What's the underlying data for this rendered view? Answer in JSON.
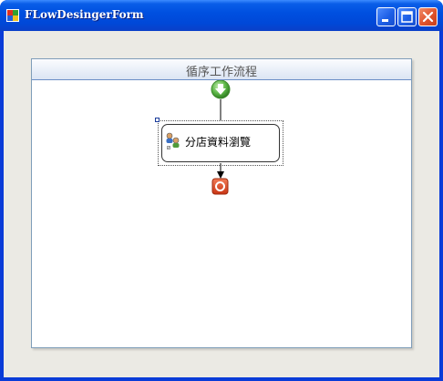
{
  "window": {
    "title": "FLowDesingerForm"
  },
  "title_buttons": {
    "minimize_icon": "minimize-icon",
    "maximize_icon": "maximize-icon",
    "close_icon": "close-icon"
  },
  "designer": {
    "title": "循序工作流程",
    "start_icon": "green-down-arrow-start-icon",
    "end_icon": "red-stop-icon",
    "activity": {
      "label": "分店資料瀏覽",
      "icon": "people-activity-icon"
    }
  },
  "colors": {
    "titlebar": "#0050e0",
    "client_background": "#ebeae4",
    "designer_border": "#7f9db9",
    "start_green": "#4fa63a",
    "end_red": "#d8431f"
  }
}
